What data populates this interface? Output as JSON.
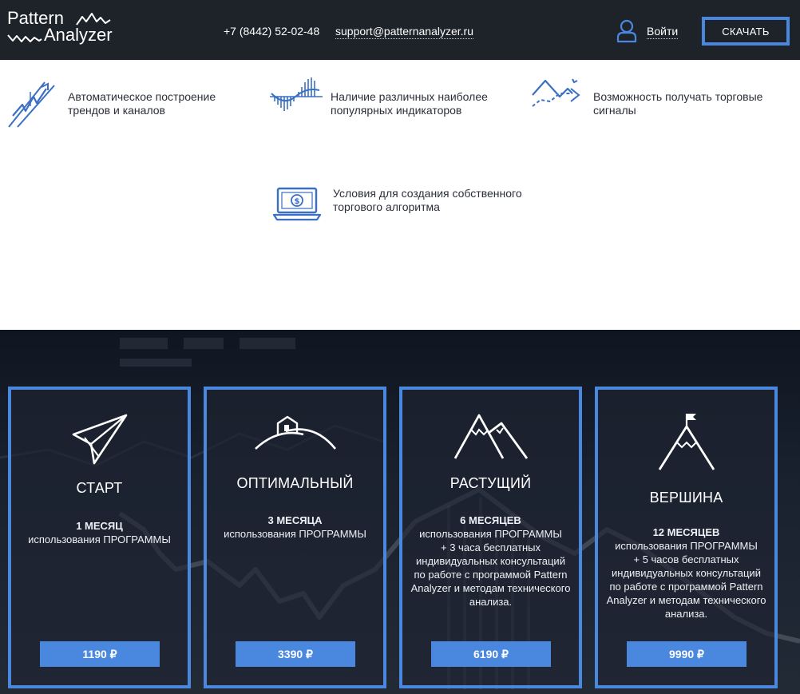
{
  "header": {
    "logo_line1": "Pattern",
    "logo_line2": "Analyzer",
    "phone": "+7 (8442) 52-02-48",
    "email": "support@patternanalyzer.ru",
    "login_label": "Войти",
    "download_label": "СКАЧАТЬ",
    "user_icon": "user-icon"
  },
  "features": [
    {
      "icon": "trend-channel-icon",
      "text1": "Автоматическое построение",
      "text2": "трендов и каналов"
    },
    {
      "icon": "indicators-icon",
      "text1": "Наличие различных наиболее",
      "text2": "популярных индикаторов"
    },
    {
      "icon": "signals-icon",
      "text1": "Возможность получать торговые",
      "text2": "сигналы"
    },
    {
      "icon": "laptop-dollar-icon",
      "text1": "Условия для создания собственного",
      "text2": "торгового алгоритма"
    }
  ],
  "plans": [
    {
      "icon": "paper-plane-icon",
      "title": "СТАРТ",
      "duration": "1 МЕСЯЦ",
      "lines": [
        "использования ПРОГРАММЫ"
      ],
      "price": "1190 ₽"
    },
    {
      "icon": "house-on-hill-icon",
      "title": "ОПТИМАЛЬНЫЙ",
      "duration": "3 МЕСЯЦА",
      "lines": [
        "использования ПРОГРАММЫ"
      ],
      "price": "3390 ₽"
    },
    {
      "icon": "mountains-icon",
      "title": "РАСТУЩИЙ",
      "duration": "6 МЕСЯЦЕВ",
      "lines": [
        "использования ПРОГРАММЫ",
        "+ 3 часа бесплатных",
        "индивидуальных консультаций",
        "по работе с программой Pattern",
        "Analyzer и методам технического",
        "анализа."
      ],
      "price": "6190 ₽"
    },
    {
      "icon": "summit-flag-icon",
      "title": "ВЕРШИНА",
      "duration": "12 МЕСЯЦЕВ",
      "lines": [
        "использования ПРОГРАММЫ",
        "+ 5 часов бесплатных",
        "индивидуальных консультаций",
        "по работе с программой Pattern",
        "Analyzer и методам технического",
        "анализа."
      ],
      "price": "9990 ₽"
    }
  ],
  "colors": {
    "header_bg": "#1e2229",
    "accent": "#4a88e0",
    "icon_blue": "#3a6fc4",
    "pricing_bg": "#1a2230"
  }
}
